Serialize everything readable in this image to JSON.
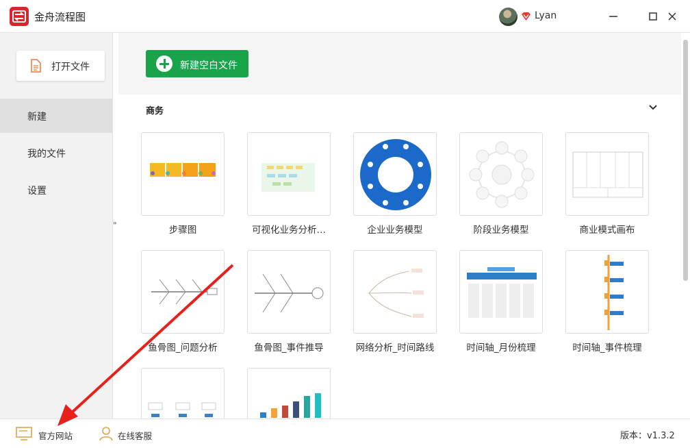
{
  "window": {
    "app_title": "金舟流程图",
    "username": "Lyan"
  },
  "sidebar": {
    "open_file_label": "打开文件",
    "nav": [
      {
        "label": "新建",
        "active": true
      },
      {
        "label": "我的文件",
        "active": false
      },
      {
        "label": "设置",
        "active": false
      }
    ],
    "collapse_glyph": "\""
  },
  "main": {
    "new_blank_label": "新建空白文件",
    "section_title": "商务",
    "templates": [
      {
        "label": "步骤图"
      },
      {
        "label": "可视化业务分析…"
      },
      {
        "label": "企业业务模型"
      },
      {
        "label": "阶段业务模型"
      },
      {
        "label": "商业模式画布"
      },
      {
        "label": "鱼骨图_问题分析"
      },
      {
        "label": "鱼骨图_事件推导"
      },
      {
        "label": "网络分析_时间路线"
      },
      {
        "label": "时间轴_月份梳理"
      },
      {
        "label": "时间轴_事件梳理"
      },
      {
        "label": ""
      },
      {
        "label": ""
      }
    ]
  },
  "footer": {
    "website_label": "官方网站",
    "support_label": "在线客服",
    "version_text": "版本：v1.3.2"
  },
  "colors": {
    "brand_red": "#d9252b",
    "new_button_green": "#1aa34a",
    "annotation_arrow": "#e8201c"
  }
}
